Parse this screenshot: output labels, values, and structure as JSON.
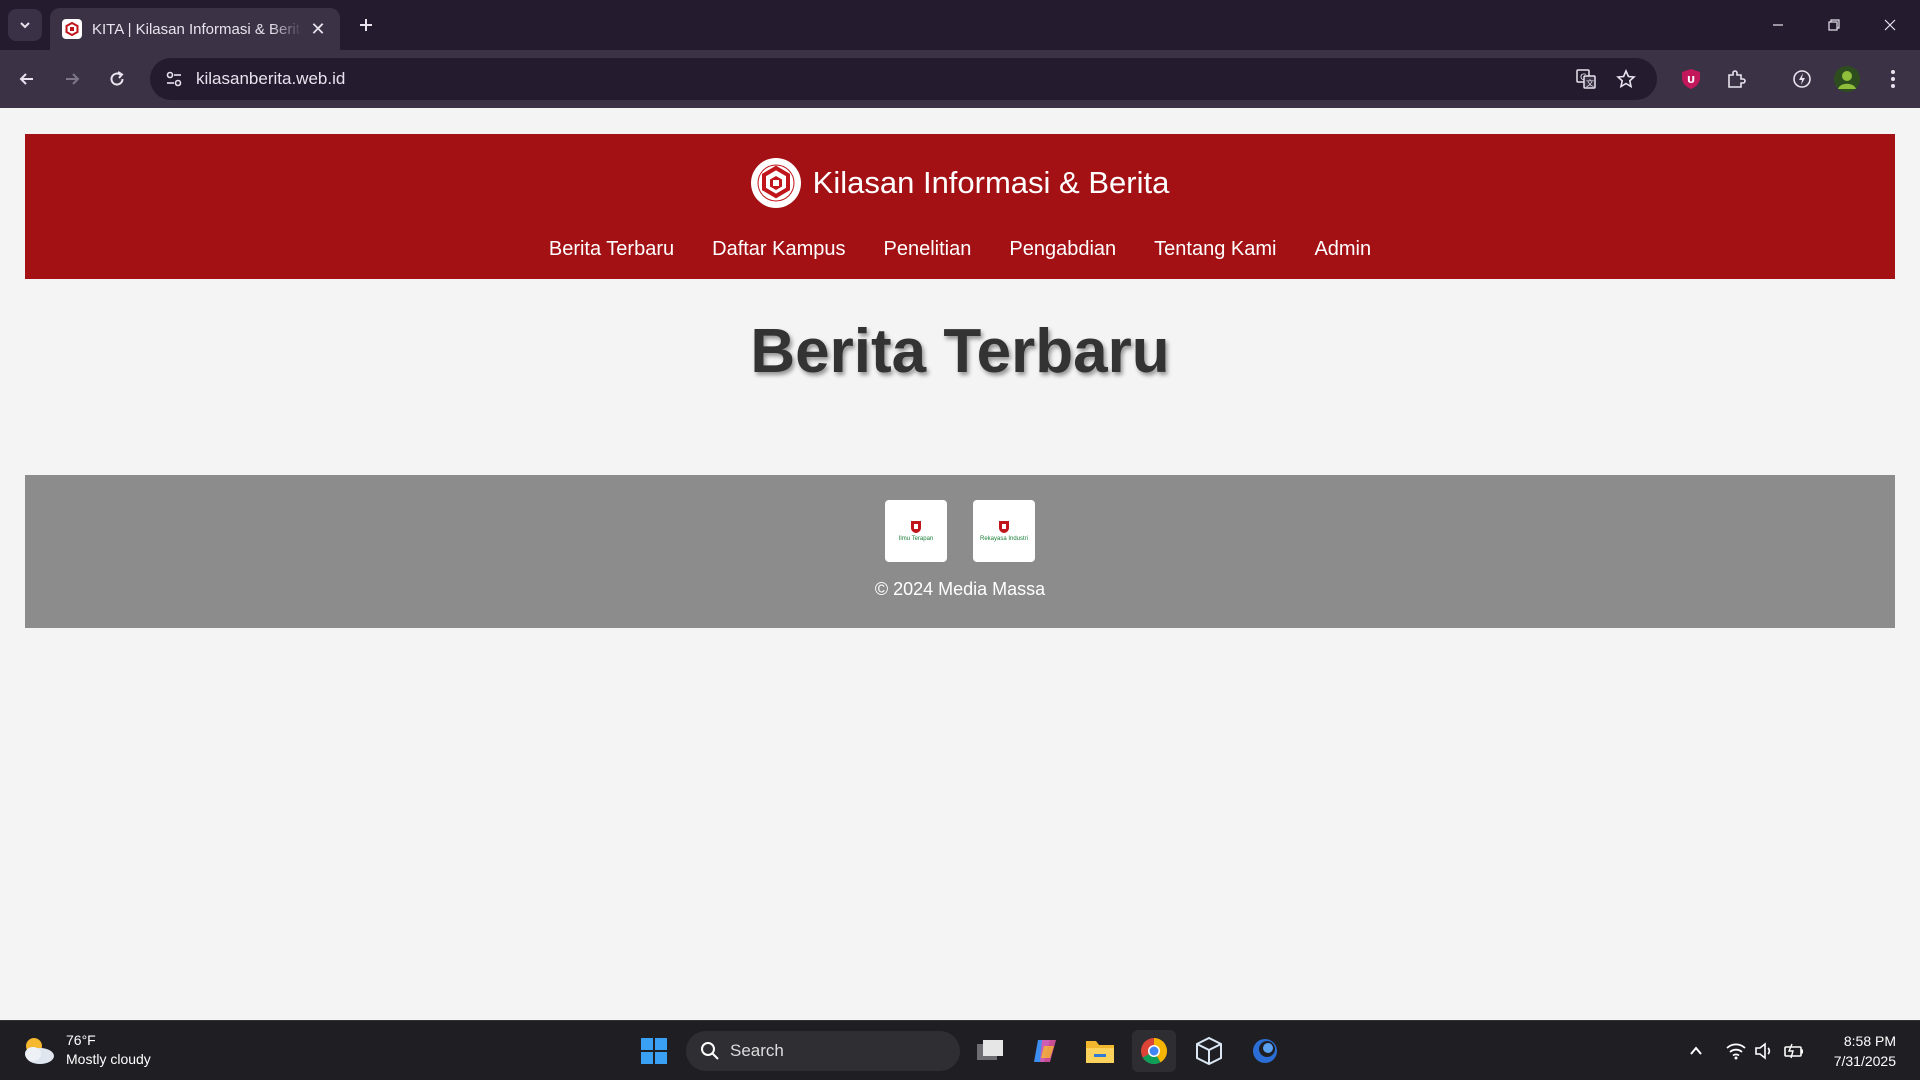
{
  "browser": {
    "tab_title": "KITA | Kilasan Informasi & Berita",
    "url": "kilasanberita.web.id"
  },
  "site": {
    "title": "Kilasan Informasi & Berita",
    "nav": [
      "Berita Terbaru",
      "Daftar Kampus",
      "Penelitian",
      "Pengabdian",
      "Tentang Kami",
      "Admin"
    ],
    "heading": "Berita Terbaru",
    "footer_text": "© 2024 Media Massa",
    "partner_logos": [
      {
        "name": "Ilmu Terapan",
        "icon": "university-emblem"
      },
      {
        "name": "Rekayasa Industri",
        "icon": "university-emblem"
      }
    ],
    "colors": {
      "header": "#a31115",
      "footer": "#8c8c8c",
      "background": "#f4f4f4"
    }
  },
  "taskbar": {
    "temperature": "76°F",
    "condition": "Mostly cloudy",
    "search_placeholder": "Search",
    "time": "8:58 PM",
    "date": "7/31/2025"
  }
}
